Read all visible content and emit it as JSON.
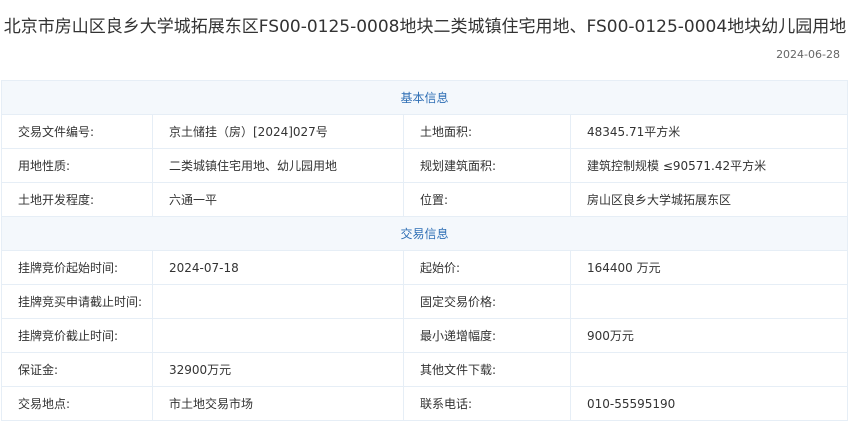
{
  "page": {
    "title": "北京市房山区良乡大学城拓展东区FS00-0125-0008地块二类城镇住宅用地、FS00-0125-0004地块幼儿园用地",
    "date": "2024-06-28"
  },
  "basic": {
    "header": "基本信息",
    "rows": [
      {
        "l1": "交易文件编号:",
        "v1": "京土储挂（房）[2024]027号",
        "l2": "土地面积:",
        "v2": "48345.71平方米"
      },
      {
        "l1": "用地性质:",
        "v1": "二类城镇住宅用地、幼儿园用地",
        "l2": "规划建筑面积:",
        "v2": "建筑控制规模 ≤90571.42平方米"
      },
      {
        "l1": "土地开发程度:",
        "v1": "六通一平",
        "l2": "位置:",
        "v2": "房山区良乡大学城拓展东区"
      }
    ]
  },
  "trade": {
    "header": "交易信息",
    "rows": [
      {
        "l1": "挂牌竞价起始时间:",
        "v1": "2024-07-18",
        "l2": "起始价:",
        "v2": "164400 万元"
      },
      {
        "l1": "挂牌竞买申请截止时间:",
        "v1": "",
        "l2": "固定交易价格:",
        "v2": ""
      },
      {
        "l1": "挂牌竞价截止时间:",
        "v1": "",
        "l2": "最小递增幅度:",
        "v2": "900万元"
      },
      {
        "l1": "保证金:",
        "v1": "32900万元",
        "l2": "其他文件下载:",
        "v2": ""
      },
      {
        "l1": "交易地点:",
        "v1": "市土地交易市场",
        "l2": "联系电话:",
        "v2": "010-55595190"
      }
    ]
  }
}
